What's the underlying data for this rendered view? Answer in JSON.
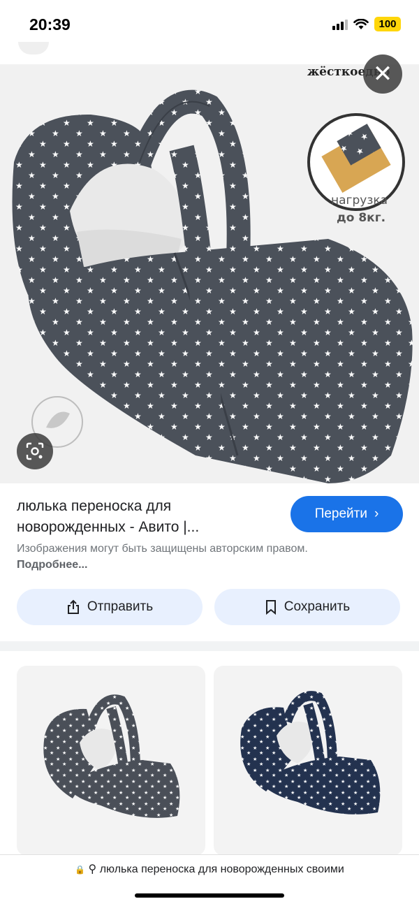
{
  "status": {
    "time": "20:39",
    "battery": "100",
    "icons": [
      "signal-icon",
      "wifi-icon",
      "battery-icon"
    ]
  },
  "viewer": {
    "close_icon": "close-icon",
    "lens_icon": "lens-icon",
    "image_text": {
      "top_right": "жёсткоедно",
      "load_line1": "нагрузка",
      "load_line2": "до 8кг."
    }
  },
  "result": {
    "title": "люлька переноска для новорожденных - Авито |...",
    "go_label": "Перейти",
    "copyright": "Изображения могут быть защищены авторским правом.",
    "more_label": "Подробнее..."
  },
  "actions": {
    "share_label": "Отправить",
    "save_label": "Сохранить"
  },
  "related": [
    {
      "color": "#4a4f58"
    },
    {
      "color": "#23324f"
    }
  ],
  "browser": {
    "address": "люлька переноска для новорожденных своими"
  },
  "colors": {
    "accent": "#1a73e8",
    "action_bg": "#e8f0fe",
    "fabric": "#4b515a",
    "battery": "#ffd60a"
  }
}
